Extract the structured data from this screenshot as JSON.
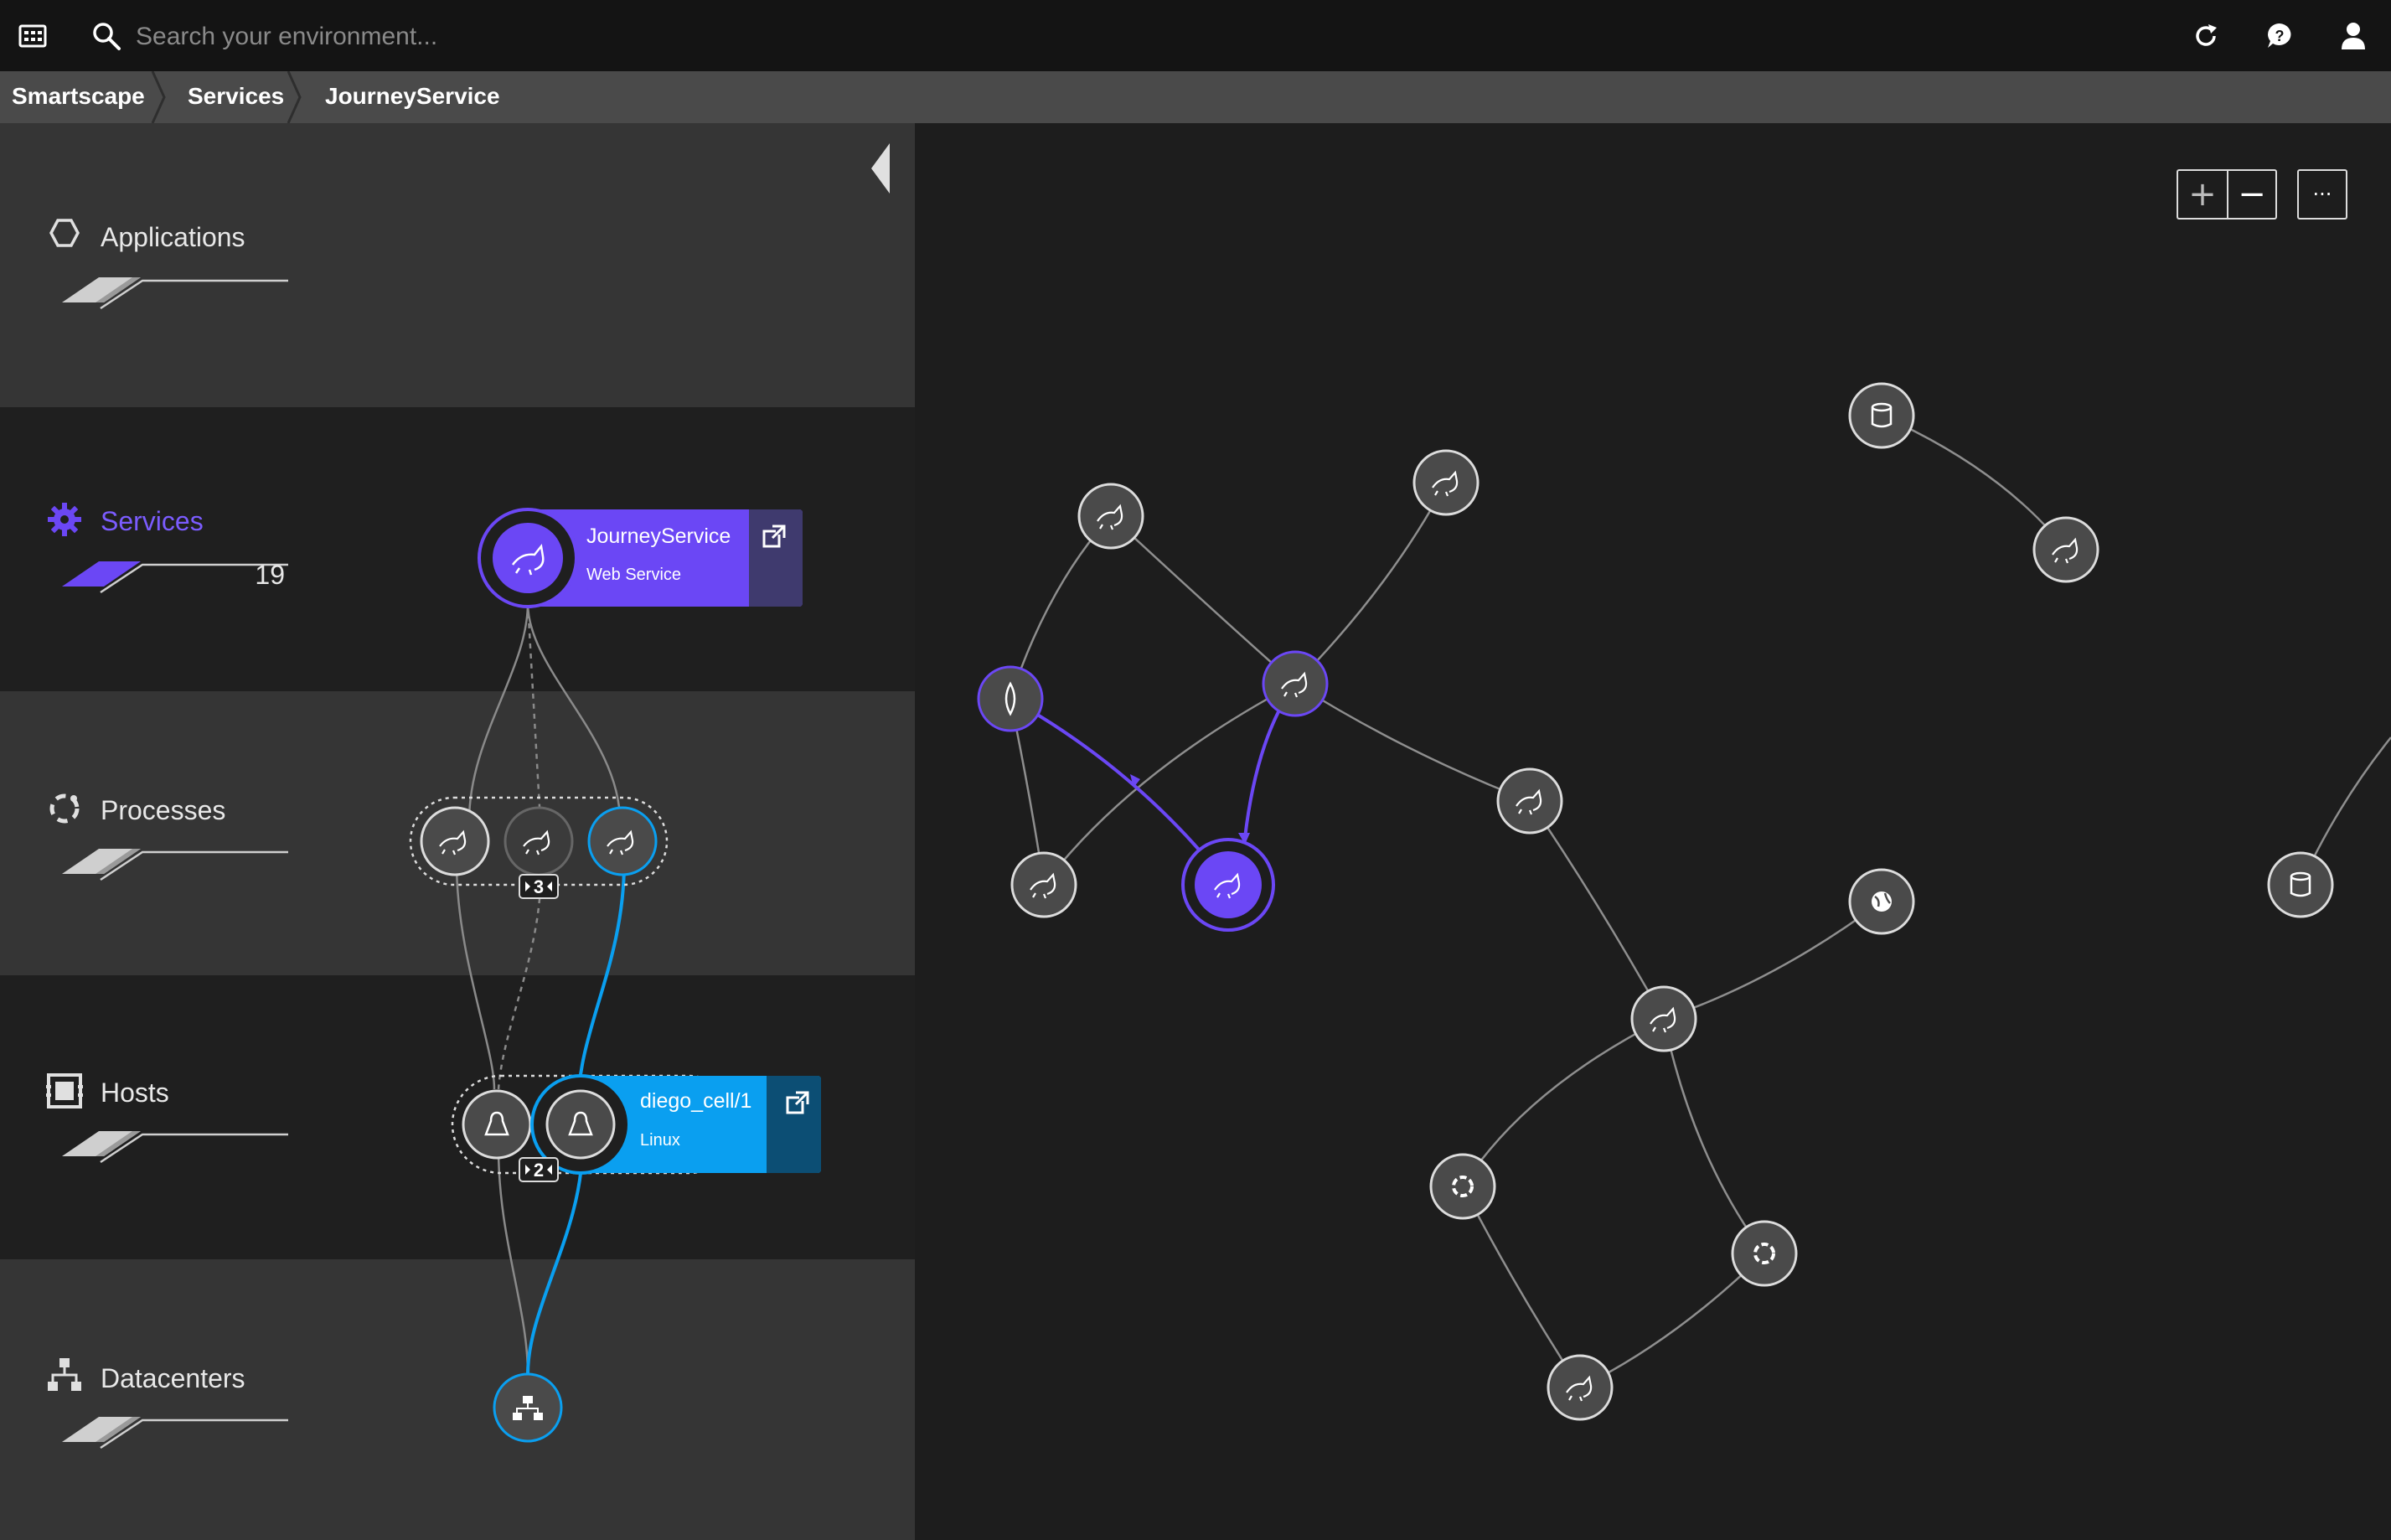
{
  "header": {
    "search_placeholder": "Search your environment..."
  },
  "breadcrumb": {
    "items": [
      "Smartscape",
      "Services",
      "JourneyService"
    ]
  },
  "layers": [
    {
      "name": "Applications",
      "count": ""
    },
    {
      "name": "Services",
      "count": "19"
    },
    {
      "name": "Processes",
      "count": ""
    },
    {
      "name": "Hosts",
      "count": ""
    },
    {
      "name": "Datacenters",
      "count": ""
    }
  ],
  "service_card": {
    "title": "JourneyService",
    "subtitle": "Web Service"
  },
  "process_group": {
    "badge": "3"
  },
  "host_card": {
    "title": "diego_cell/1",
    "subtitle": "Linux",
    "badge": "2"
  },
  "map_controls": {
    "zoom_in": "+",
    "zoom_out": "−",
    "more": "···"
  },
  "colors": {
    "accent_purple": "#6b47f5",
    "accent_blue": "#0a9ff0",
    "node_fill": "#4a4a4a"
  }
}
